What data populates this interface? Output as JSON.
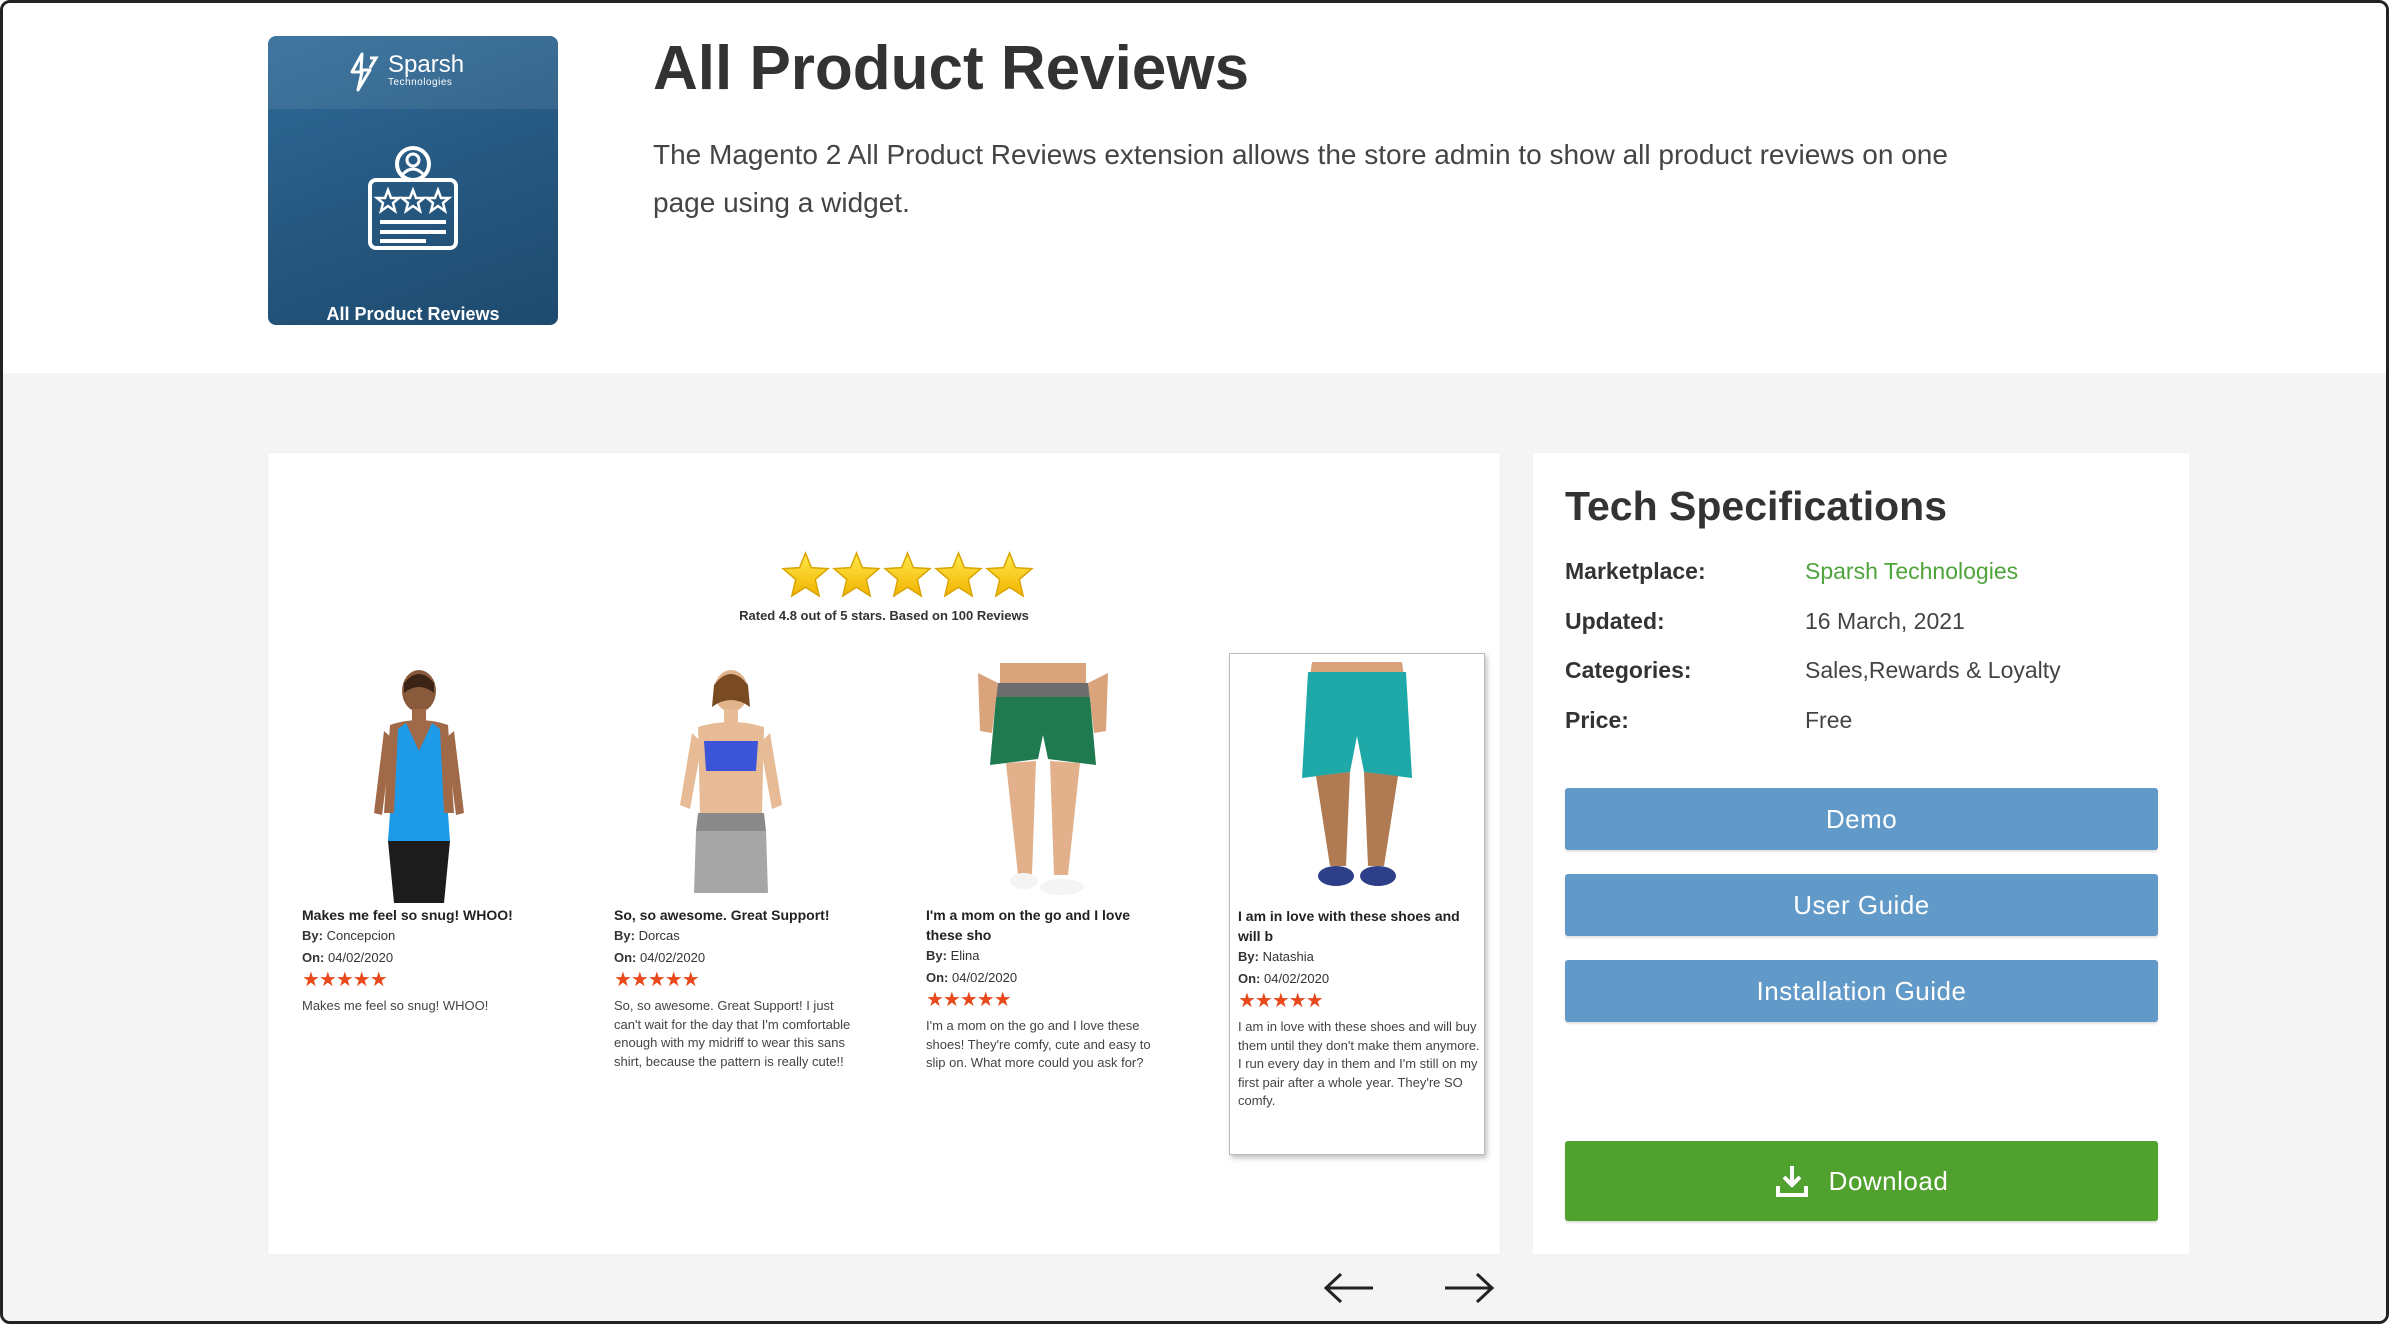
{
  "logo": {
    "brand_name": "Sparsh",
    "brand_sub": "Technologies",
    "tile_label": "All Product Reviews"
  },
  "header": {
    "title": "All Product Reviews",
    "description": "The Magento 2 All Product Reviews extension allows the store admin to show all product reviews on one page using a widget."
  },
  "preview": {
    "rating_text": "Rated 4.8 out of 5 stars. Based on 100 Reviews",
    "reviews": [
      {
        "title": "Makes me feel so snug! WHOO!",
        "by_label": "By:",
        "by": "Concepcion",
        "on_label": "On:",
        "on": "04/02/2020",
        "stars": "★★★★★",
        "text": "Makes me feel so snug! WHOO!"
      },
      {
        "title": "So, so awesome. Great Support!",
        "by_label": "By:",
        "by": "Dorcas",
        "on_label": "On:",
        "on": "04/02/2020",
        "stars": "★★★★★",
        "text": "So, so awesome. Great Support! I just can't wait for the day that I'm comfortable enough with my midriff to wear this sans shirt, because the pattern is really cute!!"
      },
      {
        "title": "I'm a mom on the go and I love these sho",
        "by_label": "By:",
        "by": "Elina",
        "on_label": "On:",
        "on": "04/02/2020",
        "stars": "★★★★★",
        "text": "I'm a mom on the go and I love these shoes! They're comfy, cute and easy to slip on. What more could you ask for?"
      },
      {
        "title": "I am in love with these shoes and will b",
        "by_label": "By:",
        "by": "Natashia",
        "on_label": "On:",
        "on": "04/02/2020",
        "stars": "★★★★★",
        "text": "I am in love with these shoes and will buy them until they don't make them anymore. I run every day in them and I'm still on my first pair after a whole year. They're SO comfy."
      }
    ]
  },
  "specs": {
    "title": "Tech Specifications",
    "rows": [
      {
        "key": "Marketplace:",
        "value": "Sparsh Technologies"
      },
      {
        "key": "Updated:",
        "value": "16 March, 2021"
      },
      {
        "key": "Categories:",
        "value": "Sales,Rewards & Loyalty"
      },
      {
        "key": "Price:",
        "value": "Free"
      }
    ],
    "buttons": {
      "demo": "Demo",
      "user_guide": "User Guide",
      "install_guide": "Installation Guide",
      "download": "Download"
    }
  },
  "colors": {
    "link_green": "#4ea33a",
    "button_blue": "#6199c8",
    "download_green": "#51a12e",
    "review_star": "#e8491d",
    "tile_blue": "#2a6391"
  }
}
